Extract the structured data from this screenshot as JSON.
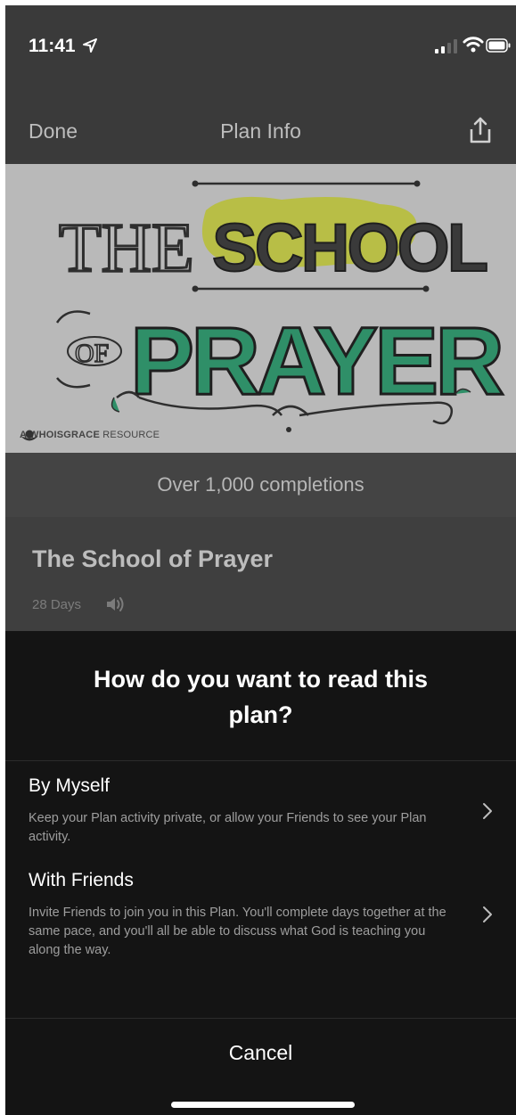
{
  "status": {
    "time": "11:41"
  },
  "nav": {
    "done": "Done",
    "title": "Plan Info"
  },
  "hero": {
    "art_line1_a": "THE",
    "art_line1_b": "SCHOOL",
    "art_line2_a": "OF",
    "art_line2_b": "PRAYER",
    "credit_brand": "A WHOISGRACE",
    "credit_suffix": "RESOURCE",
    "accent_green": "#2f8f68",
    "accent_yellow": "#b8bf3a"
  },
  "plan": {
    "completions": "Over 1,000 completions",
    "title": "The School of Prayer",
    "days": "28 Days"
  },
  "sheet": {
    "question": "How do you want to read this plan?",
    "options": [
      {
        "title": "By Myself",
        "description": "Keep your Plan activity private, or allow your Friends to see your Plan activity."
      },
      {
        "title": "With Friends",
        "description": "Invite Friends to join you in this Plan. You'll complete days together at the same pace, and you'll all be able to discuss what God is teaching you along the way."
      }
    ],
    "cancel": "Cancel"
  }
}
